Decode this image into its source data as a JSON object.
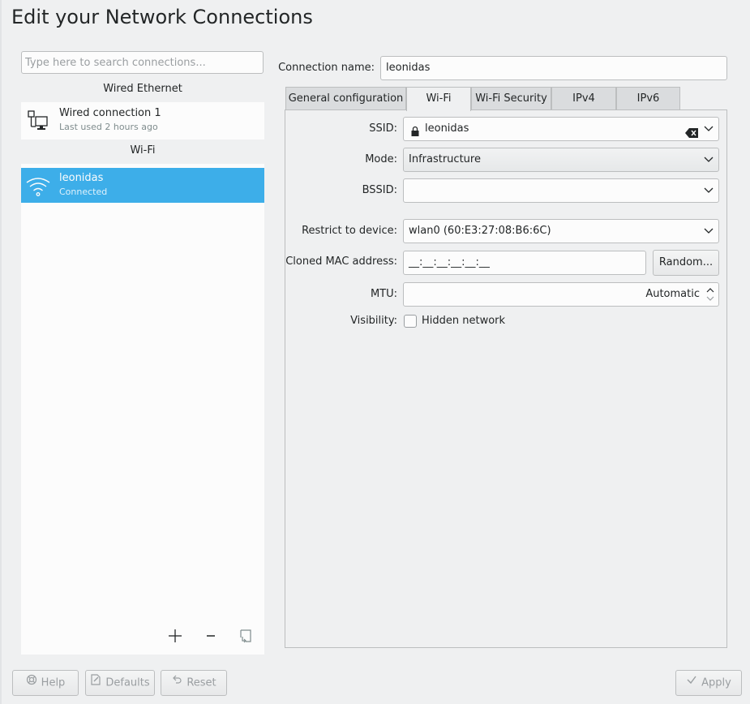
{
  "window": {
    "title": "Edit your Network Connections"
  },
  "sidebar": {
    "search_placeholder": "Type here to search connections...",
    "sections": [
      {
        "header": "Wired Ethernet",
        "items": [
          {
            "name": "Wired connection 1",
            "status": "Last used 2 hours ago",
            "icon": "wired-network-icon",
            "selected": false
          }
        ]
      },
      {
        "header": "Wi-Fi",
        "items": [
          {
            "name": "leonidas",
            "status": "Connected",
            "icon": "wifi-icon",
            "selected": true
          }
        ]
      }
    ],
    "tools": {
      "add": "add-icon",
      "remove": "remove-icon",
      "import": "import-icon"
    }
  },
  "editor": {
    "connection_name_label": "Connection name:",
    "connection_name_value": "leonidas",
    "tabs": [
      {
        "label": "General configuration",
        "active": false
      },
      {
        "label": "Wi-Fi",
        "active": true
      },
      {
        "label": "Wi-Fi Security",
        "active": false
      },
      {
        "label": "IPv4",
        "active": false
      },
      {
        "label": "IPv6",
        "active": false
      }
    ],
    "wifi": {
      "ssid_label": "SSID:",
      "ssid_value": "leonidas",
      "mode_label": "Mode:",
      "mode_value": "Infrastructure",
      "bssid_label": "BSSID:",
      "bssid_value": "",
      "restrict_label": "Restrict to device:",
      "restrict_value": "wlan0 (60:E3:27:08:B6:6C)",
      "mac_label": "Cloned MAC address:",
      "mac_value": "__:__:__:__:__:__",
      "random_button": "Random...",
      "mtu_label": "MTU:",
      "mtu_value": "Automatic",
      "visibility_label": "Visibility:",
      "hidden_network_label": "Hidden network",
      "hidden_network_checked": false
    }
  },
  "footer": {
    "help": "Help",
    "defaults": "Defaults",
    "reset": "Reset",
    "apply": "Apply"
  },
  "colors": {
    "selection": "#3daee9",
    "window_bg": "#eff0f1",
    "view_bg": "#fcfcfc",
    "border": "#bcbebf"
  }
}
